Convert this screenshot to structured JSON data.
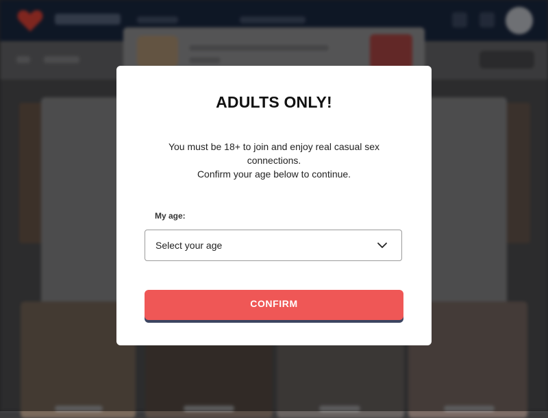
{
  "modal": {
    "title": "ADULTS ONLY!",
    "text_line1": "You must be 18+ to join and enjoy real casual sex",
    "text_line2": "connections.",
    "text_line3": "Confirm your age below to continue.",
    "age_label": "My age:",
    "age_select_value": "Select your age",
    "confirm_label": "CONFIRM"
  },
  "colors": {
    "accent": "#ef5756",
    "button_shadow": "#3b4460",
    "header_bg": "#1b2a44"
  },
  "icons": {
    "logo": "heart-logo-icon",
    "select_chevron": "chevron-down-icon"
  }
}
